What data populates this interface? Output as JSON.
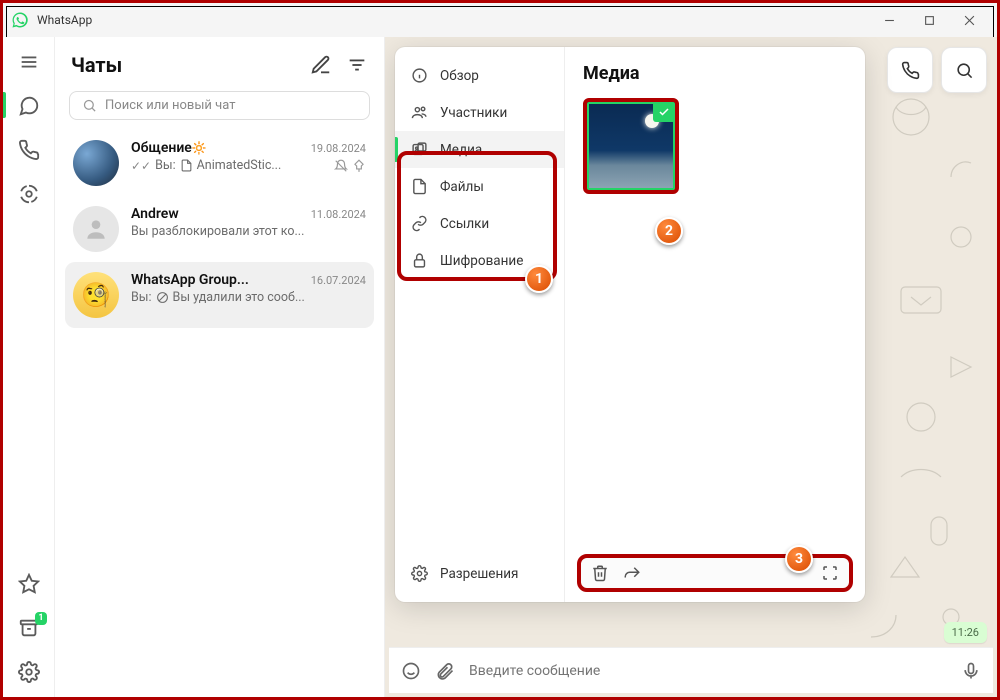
{
  "window": {
    "title": "WhatsApp"
  },
  "sidebar": {
    "archive_badge": "1"
  },
  "chatlist": {
    "title": "Чаты",
    "search_placeholder": "Поиск или новый чат",
    "items": [
      {
        "name": "Общение",
        "emoji": "🔆",
        "date": "19.08.2024",
        "preview_prefix": "Вы:",
        "preview": "AnimatedStic..."
      },
      {
        "name": "Andrew",
        "date": "11.08.2024",
        "preview": "Вы разблокировали этот ко..."
      },
      {
        "name": "WhatsApp Group...",
        "date": "16.07.2024",
        "preview_prefix": "Вы:",
        "preview": "Вы удалили это сооб..."
      }
    ]
  },
  "infopanel": {
    "menu": {
      "overview": "Обзор",
      "participants": "Участники",
      "media": "Медиа",
      "files": "Файлы",
      "links": "Ссылки",
      "encryption": "Шифрование",
      "permissions": "Разрешения"
    },
    "media_title": "Медиа"
  },
  "composer": {
    "placeholder": "Введите сообщение"
  },
  "message": {
    "time": "11:26"
  },
  "annotations": {
    "b1": "1",
    "b2": "2",
    "b3": "3"
  }
}
